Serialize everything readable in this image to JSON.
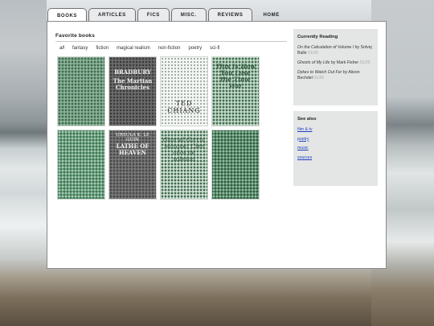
{
  "tabs": [
    {
      "label": "Books",
      "active": true
    },
    {
      "label": "Articles",
      "active": false
    },
    {
      "label": "Fics",
      "active": false
    },
    {
      "label": "Misc.",
      "active": false
    },
    {
      "label": "Reviews",
      "active": false
    },
    {
      "label": "Home",
      "active": false
    }
  ],
  "main": {
    "section_title": "Favorite books",
    "filters": [
      "all",
      "fantasy",
      "fiction",
      "magical realism",
      "non-fiction",
      "poetry",
      "sci-fi"
    ],
    "covers": [
      {
        "title": "",
        "author": ""
      },
      {
        "title": "The Martian Chronicles",
        "author": "BRADBURY"
      },
      {
        "title": "",
        "author": "TED CHIANG"
      },
      {
        "title": "This Is How You Lose the Time War",
        "author": ""
      },
      {
        "title": "",
        "author": ""
      },
      {
        "title": "LATHE OF HEAVEN",
        "author": "URSULA K. LE GUIN"
      },
      {
        "title": "Gabriel García Márquez Cien años de soledad",
        "author": ""
      },
      {
        "title": "",
        "author": ""
      }
    ]
  },
  "sidebar": {
    "reading_title": "Currently Reading",
    "reading": [
      {
        "book": "On the Calculation of Volume I",
        "by": "by",
        "author": "Solvej Balle",
        "date": "01/25"
      },
      {
        "book": "Ghosts of My Life",
        "by": "by",
        "author": "Mark Fisher",
        "date": "01/25"
      },
      {
        "book": "Dykes to Watch Out For",
        "by": "by",
        "author": "Alison Bechdel",
        "date": "01/25"
      }
    ],
    "seealso_title": "See also",
    "links": [
      "film & tv",
      "poetry",
      "music",
      "sources"
    ]
  }
}
